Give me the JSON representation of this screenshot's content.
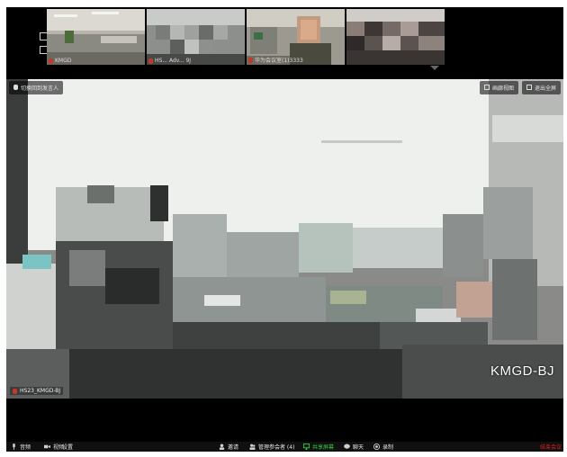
{
  "thumbnails": [
    {
      "label": "KMGD"
    },
    {
      "label": "HS... Adv... 9J"
    },
    {
      "label": "华为会议室(1)3333"
    },
    {
      "label": ""
    }
  ],
  "main_view": {
    "switch_speaker": "切换回到发言人",
    "gallery_view": "画廊视图",
    "exit_fullscreen": "退出全屏",
    "site_name": "KMGD-BJ",
    "speaker_label": "HS23_KMGD-BJ"
  },
  "toolbar": {
    "audio": "音频",
    "video_label": "视频",
    "settings": "设置",
    "invite": "邀请",
    "participants": "管理参会者 (4)",
    "share": "共享屏幕",
    "chat": "聊天",
    "record": "录制",
    "end": "结束会议"
  },
  "colors": {
    "share_green": "#2ecc40",
    "end_red": "#e0201f"
  }
}
